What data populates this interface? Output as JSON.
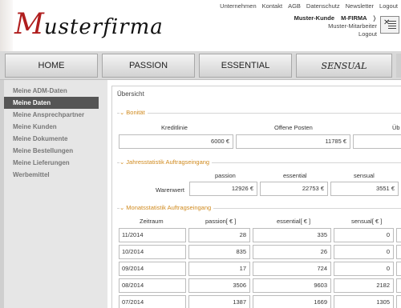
{
  "header": {
    "logo": {
      "first": "M",
      "rest": "usterfirma"
    },
    "top_links": [
      "Unternehmen",
      "Kontakt",
      "AGB",
      "Datenschutz",
      "Newsletter",
      "Logout"
    ],
    "user": {
      "name": "Muster-Kunde",
      "company": "M-FIRMA",
      "chevron": "❭",
      "role": "Muster-Mitarbeiter",
      "logout": "Logout"
    }
  },
  "nav": {
    "tabs": [
      "HOME",
      "PASSION",
      "ESSENTIAL",
      "SENSUAL"
    ]
  },
  "sidebar": {
    "items": [
      {
        "label": "Meine ADM-Daten",
        "active": false
      },
      {
        "label": "Meine Daten",
        "active": true
      },
      {
        "label": "Meine Ansprechpartner",
        "active": false
      },
      {
        "label": "Meine Kunden",
        "active": false
      },
      {
        "label": "Meine Dokumente",
        "active": false
      },
      {
        "label": "Meine Bestellungen",
        "active": false
      },
      {
        "label": "Meine Lieferungen",
        "active": false
      },
      {
        "label": "Werbemittel",
        "active": false
      }
    ]
  },
  "main": {
    "title": "Übersicht",
    "bonitaet": {
      "legend": "Bonität",
      "headers": [
        "Kreditlinie",
        "Offene Posten",
        "Üb"
      ],
      "values": [
        "6000 €",
        "11785 €",
        ""
      ]
    },
    "jahresstatistik": {
      "legend": "Jahresstatistik Auftragseingang",
      "headers": [
        "passion",
        "essential",
        "sensual"
      ],
      "row_label": "Warenwert",
      "values": [
        "12926 €",
        "22753 €",
        "3551 €"
      ]
    },
    "monatsstatistik": {
      "legend": "Monatsstatistik Auftragseingang",
      "headers": [
        "Zeitraum",
        "passion[ € ]",
        "essential[ € ]",
        "sensual[ € ]"
      ],
      "rows": [
        [
          "11/2014",
          "28",
          "335",
          "0"
        ],
        [
          "10/2014",
          "835",
          "26",
          "0"
        ],
        [
          "09/2014",
          "17",
          "724",
          "0"
        ],
        [
          "08/2014",
          "3506",
          "9603",
          "2182"
        ],
        [
          "07/2014",
          "1387",
          "1669",
          "1305"
        ]
      ]
    }
  },
  "icons": {
    "fieldset_toggle": "chevron-down-icon",
    "cart": "cart-icon"
  },
  "colors": {
    "brand_red": "#b01e1e",
    "legend_orange": "#d08a1e",
    "sidebar_active": "#555555"
  }
}
